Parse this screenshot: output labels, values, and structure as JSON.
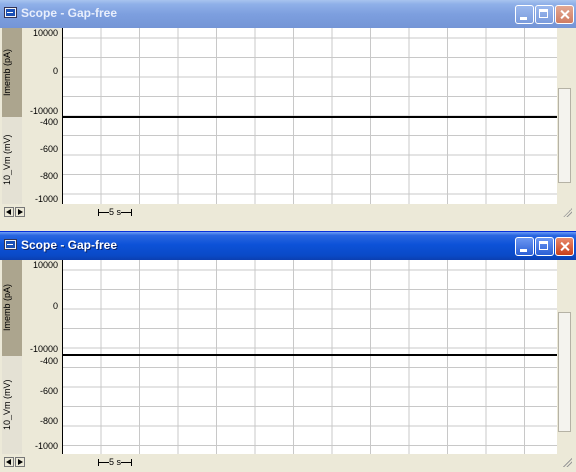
{
  "windows": [
    {
      "title": "Scope - Gap-free",
      "state": "inactive",
      "channels": [
        {
          "name": "Imemb",
          "unit": "(pA)",
          "ticks": [
            {
              "value": 10000,
              "label": "10000"
            },
            {
              "value": 0,
              "label": "0"
            },
            {
              "value": -10000,
              "label": "-10000"
            }
          ],
          "ylim": [
            -10000,
            10000
          ]
        },
        {
          "name": "10_Vm",
          "unit": "(mV)",
          "ticks": [
            {
              "value": -400,
              "label": "-400"
            },
            {
              "value": -600,
              "label": "-600"
            },
            {
              "value": -800,
              "label": "-800"
            },
            {
              "value": -1000,
              "label": "-1000"
            }
          ],
          "ylim": [
            -1000,
            -360
          ]
        }
      ],
      "time_scale": "5 s"
    },
    {
      "title": "Scope - Gap-free",
      "state": "active",
      "channels": [
        {
          "name": "Imemb",
          "unit": "(pA)",
          "ticks": [
            {
              "value": 10000,
              "label": "10000"
            },
            {
              "value": 0,
              "label": "0"
            },
            {
              "value": -10000,
              "label": "-10000"
            }
          ],
          "ylim": [
            -10000,
            10000
          ]
        },
        {
          "name": "10_Vm",
          "unit": "(mV)",
          "ticks": [
            {
              "value": -400,
              "label": "-400"
            },
            {
              "value": -600,
              "label": "-600"
            },
            {
              "value": -800,
              "label": "-800"
            },
            {
              "value": -1000,
              "label": "-1000"
            }
          ],
          "ylim": [
            -1000,
            -360
          ]
        }
      ],
      "time_scale": "5 s"
    }
  ],
  "colors": {
    "active_title": "#0a49c6",
    "inactive_title": "#7d9fdf",
    "selected_channel": "#aca58e",
    "grid": "#c8c8c8",
    "plot_bg": "#ffffff"
  }
}
